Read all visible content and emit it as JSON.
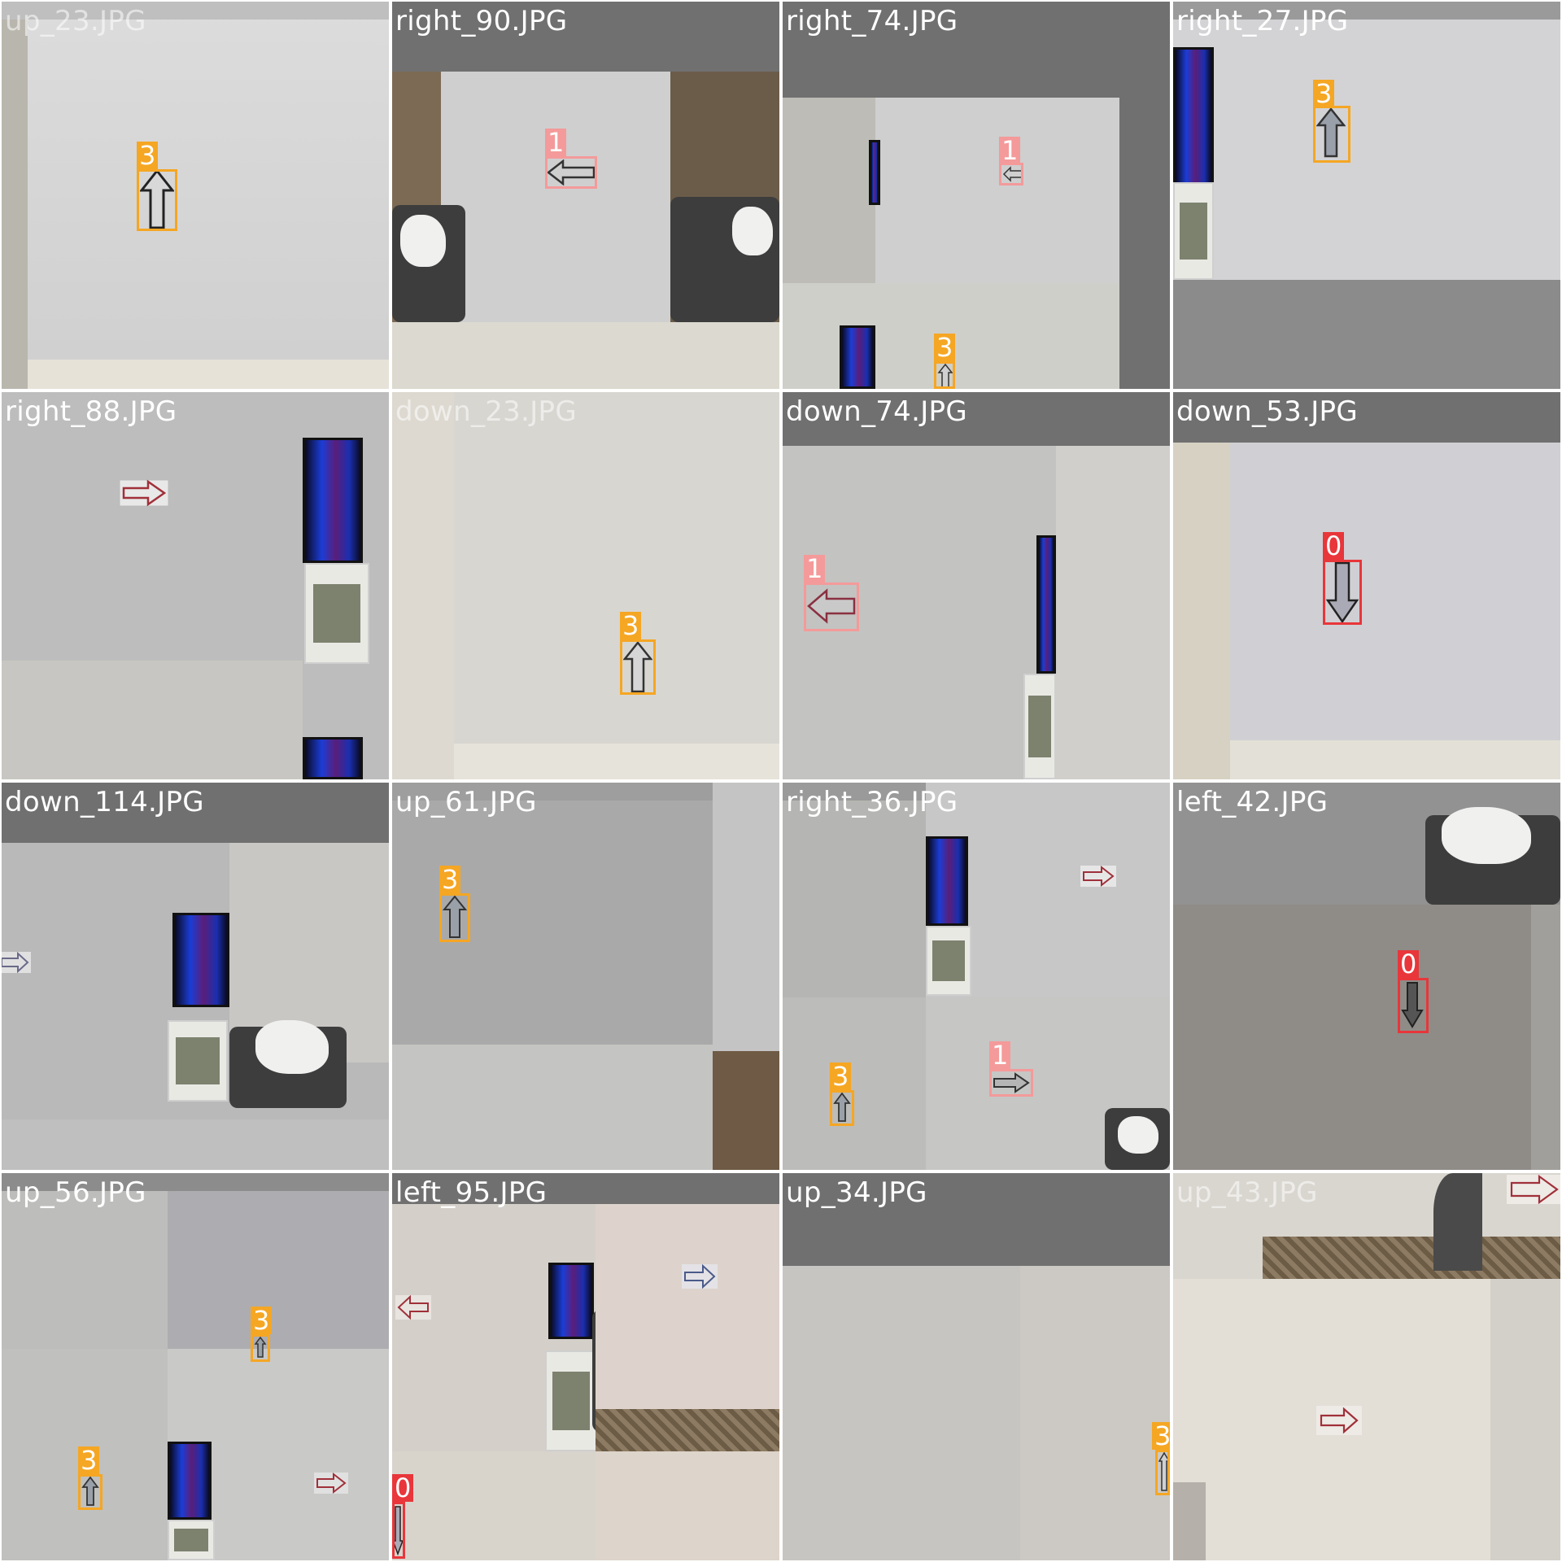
{
  "tiles": [
    {
      "label": "up_23.JPG"
    },
    {
      "label": "right_90.JPG"
    },
    {
      "label": "right_74.JPG"
    },
    {
      "label": "right_27.JPG"
    },
    {
      "label": "right_88.JPG"
    },
    {
      "label": "down_23.JPG"
    },
    {
      "label": "down_74.JPG"
    },
    {
      "label": "down_53.JPG"
    },
    {
      "label": "down_114.JPG"
    },
    {
      "label": "up_61.JPG"
    },
    {
      "label": "right_36.JPG"
    },
    {
      "label": "left_42.JPG"
    },
    {
      "label": "up_56.JPG"
    },
    {
      "label": "left_95.JPG"
    },
    {
      "label": "up_34.JPG"
    },
    {
      "label": "up_43.JPG"
    }
  ],
  "detections": {
    "t0": [
      "3"
    ],
    "t1": [
      "1"
    ],
    "t2": [
      "1",
      "3"
    ],
    "t3": [
      "3"
    ],
    "t5": [
      "3"
    ],
    "t6": [
      "1"
    ],
    "t7": [
      "0"
    ],
    "t9": [
      "3"
    ],
    "t10": [
      "3",
      "1"
    ],
    "t11": [
      "0"
    ],
    "t12": [
      "3",
      "3"
    ],
    "t13": [
      "0"
    ],
    "t14": [
      "3"
    ]
  },
  "colors": {
    "class_0": "#e8363a",
    "class_1": "#f49a9a",
    "class_3": "#f5a623",
    "band": "#707070"
  }
}
